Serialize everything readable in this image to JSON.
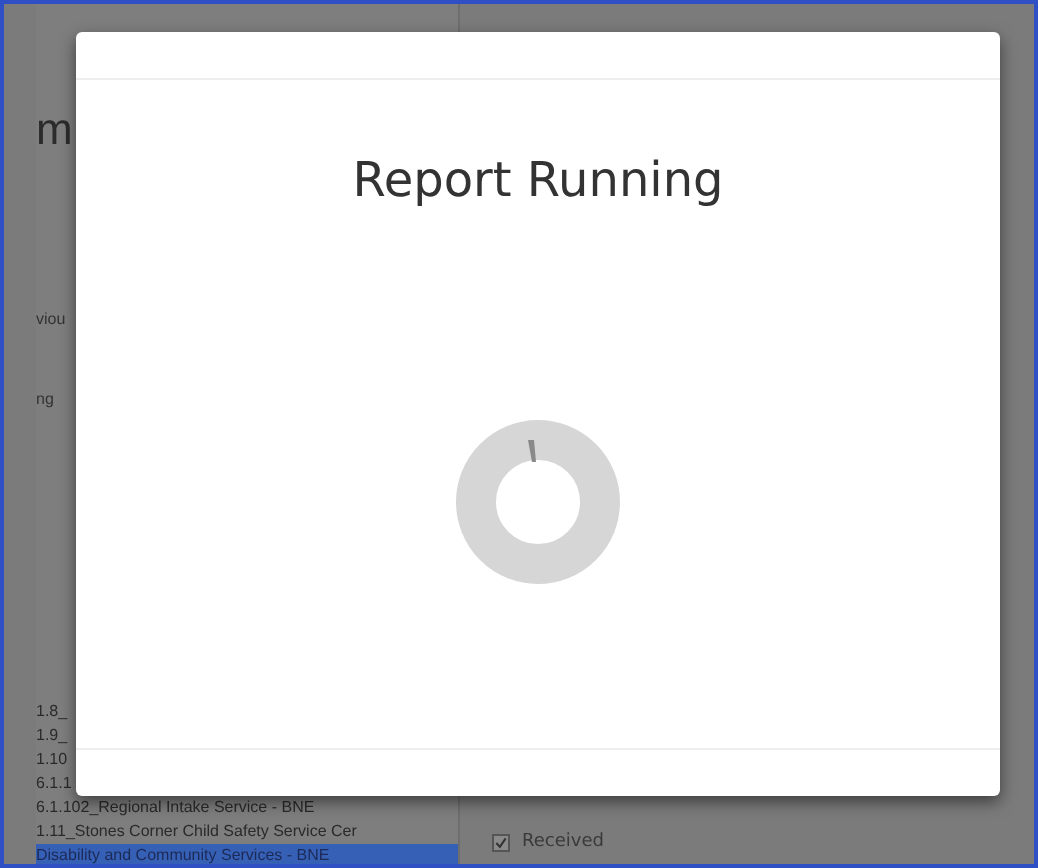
{
  "background": {
    "title_fragment": "m",
    "tab_fragment": "viou",
    "label_fragment": "ng",
    "list_items": [
      {
        "text": "1.8_",
        "selected": false
      },
      {
        "text": "1.9_",
        "selected": false
      },
      {
        "text": "1.10",
        "selected": false
      },
      {
        "text": "6.1.1",
        "selected": false
      },
      {
        "text": "6.1.102_Regional Intake Service - BNE",
        "selected": false
      },
      {
        "text": "1.11_Stones Corner Child Safety Service Cer",
        "selected": false
      },
      {
        "text": "Disability and Community Services - BNE",
        "selected": true
      }
    ],
    "checkboxes": [
      {
        "label": "Received",
        "checked": true
      }
    ]
  },
  "modal": {
    "title": "Report Running"
  }
}
